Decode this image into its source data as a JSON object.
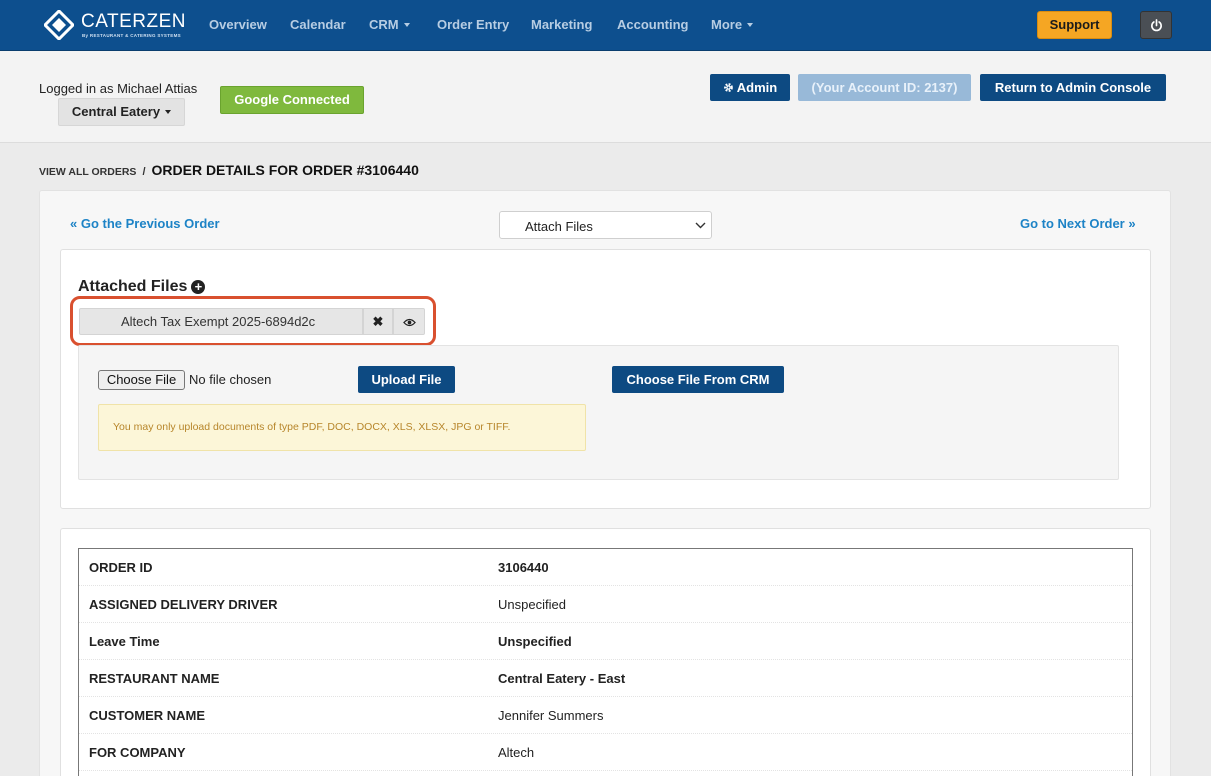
{
  "nav": {
    "brand": "CATERZEN",
    "brand_sub": "By RESTAURANT & CATERING SYSTEMS",
    "items": [
      {
        "label": "Overview",
        "dropdown": false
      },
      {
        "label": "Calendar",
        "dropdown": false
      },
      {
        "label": "CRM",
        "dropdown": true
      },
      {
        "label": "Order Entry",
        "dropdown": false
      },
      {
        "label": "Marketing",
        "dropdown": false
      },
      {
        "label": "Accounting",
        "dropdown": false
      },
      {
        "label": "More",
        "dropdown": true
      }
    ],
    "support_label": "Support",
    "power_icon": "power-icon"
  },
  "subheader": {
    "logged_in_text": "Logged in as Michael Attias",
    "location_label": "Central Eatery",
    "google_label": "Google Connected",
    "admin_label": "Admin",
    "account_label": "(Your Account ID: 2137)",
    "return_label": "Return to Admin Console"
  },
  "breadcrumb": {
    "parent": "VIEW ALL ORDERS",
    "separator": "/",
    "current": "ORDER DETAILS FOR ORDER #3106440"
  },
  "order_nav": {
    "prev_label": "« Go the Previous Order",
    "next_label": "Go to Next Order »",
    "action_select_value": "Attach Files"
  },
  "attached_files": {
    "title": "Attached Files",
    "files": [
      {
        "name": "Altech Tax Exempt 2025-6894d2c"
      }
    ],
    "choose_file_label": "Choose File",
    "no_file_text": "No file chosen",
    "upload_label": "Upload File",
    "crm_label": "Choose File From CRM",
    "warning_text": "You may only upload documents of type PDF, DOC, DOCX, XLS, XLSX, JPG or TIFF."
  },
  "details": {
    "rows": [
      {
        "label": "ORDER ID",
        "value": "3106440"
      },
      {
        "label": "ASSIGNED DELIVERY DRIVER",
        "value": "Unspecified"
      },
      {
        "label": "Leave Time",
        "value": "Unspecified"
      },
      {
        "label": "RESTAURANT NAME",
        "value": "Central Eatery - East"
      },
      {
        "label": "CUSTOMER NAME",
        "value": "Jennifer Summers"
      },
      {
        "label": "FOR COMPANY",
        "value": "Altech"
      }
    ]
  },
  "colors": {
    "navbar": "#0d4f8e",
    "primary_button": "#0d4a82",
    "support": "#f5a623",
    "google": "#7fb93d",
    "link": "#1d83c6",
    "highlight": "#d9502f"
  }
}
